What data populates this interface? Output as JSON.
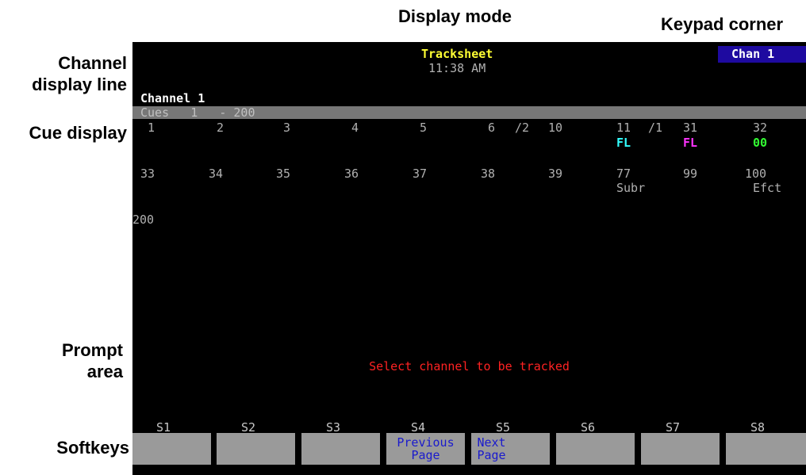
{
  "callouts": {
    "display_mode": "Display mode",
    "keypad_corner": "Keypad corner",
    "channel_display_line_1": "Channel",
    "channel_display_line_2": "display line",
    "cue_display": "Cue display",
    "prompt_area_1": "Prompt",
    "prompt_area_2": "area",
    "softkeys": "Softkeys"
  },
  "screen": {
    "title": "Tracksheet",
    "time": "11:38 AM",
    "keypad": "Chan 1",
    "channel": "Channel 1",
    "cues_header": "Cues   1   - 200",
    "prompt": "Select channel to be tracked",
    "row1": [
      "1",
      "2",
      "3",
      "4",
      "5",
      "6",
      "/2",
      "10",
      "11",
      "/1",
      "31",
      "32"
    ],
    "row1_tags": {
      "fl1": "FL",
      "fl2": "FL",
      "oo": "00"
    },
    "row2": [
      "33",
      "34",
      "35",
      "36",
      "37",
      "38",
      "39",
      "77",
      "99",
      "100"
    ],
    "row2_tags": {
      "subr": "Subr",
      "efct": "Efct"
    },
    "row3": [
      "200"
    ],
    "softkeys": {
      "labels": [
        "S1",
        "S2",
        "S3",
        "S4",
        "S5",
        "S6",
        "S7",
        "S8"
      ],
      "s4_text": "Previous\nPage",
      "s5_text": "Next\nPage"
    }
  },
  "colors": {
    "background": "#000000",
    "title": "#ffff33",
    "prompt": "#ff2222",
    "keypad_box": "#1e0aa0",
    "cues_bar": "#777777",
    "softkey_face": "#9a9a9a",
    "softkey_text": "#1a1acd",
    "fl_cyan": "#33ffff",
    "fl_magenta": "#ff33ff",
    "oo_green": "#33ff33"
  }
}
